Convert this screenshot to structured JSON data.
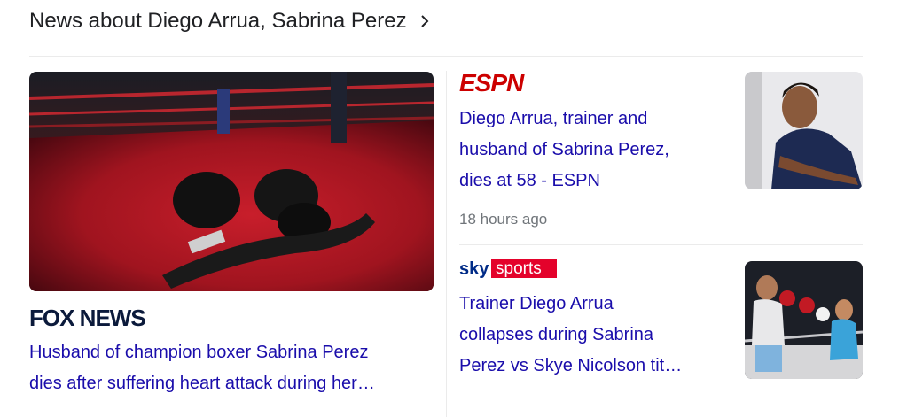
{
  "header": {
    "title": "News about Diego Arrua, Sabrina Perez"
  },
  "big_story": {
    "source": "FOX NEWS",
    "title_lines": [
      "Husband of champion boxer Sabrina Perez",
      "dies after suffering heart attack during her…"
    ],
    "thumbnail": "boxing-gloves-in-ring-image"
  },
  "stories": [
    {
      "source": "ESPN",
      "title_lines": [
        "Diego Arrua, trainer and",
        "husband of Sabrina Perez,",
        "dies at 58 - ESPN"
      ],
      "time": "18 hours ago",
      "thumbnail": "boxer-portrait-image"
    },
    {
      "source": "sky sports",
      "source_parts": [
        "sky",
        "sports"
      ],
      "title_lines": [
        "Trainer Diego Arrua",
        "collapses during Sabrina",
        "Perez vs Skye Nicolson tit…"
      ],
      "thumbnail": "boxing-match-image"
    }
  ],
  "colors": {
    "link": "#1a0dab",
    "text": "#202124",
    "meta": "#70757a",
    "espn_red": "#cc0000",
    "sky_red": "#e4022b",
    "sky_blue": "#002b87",
    "fox_navy": "#0b1a3b"
  }
}
